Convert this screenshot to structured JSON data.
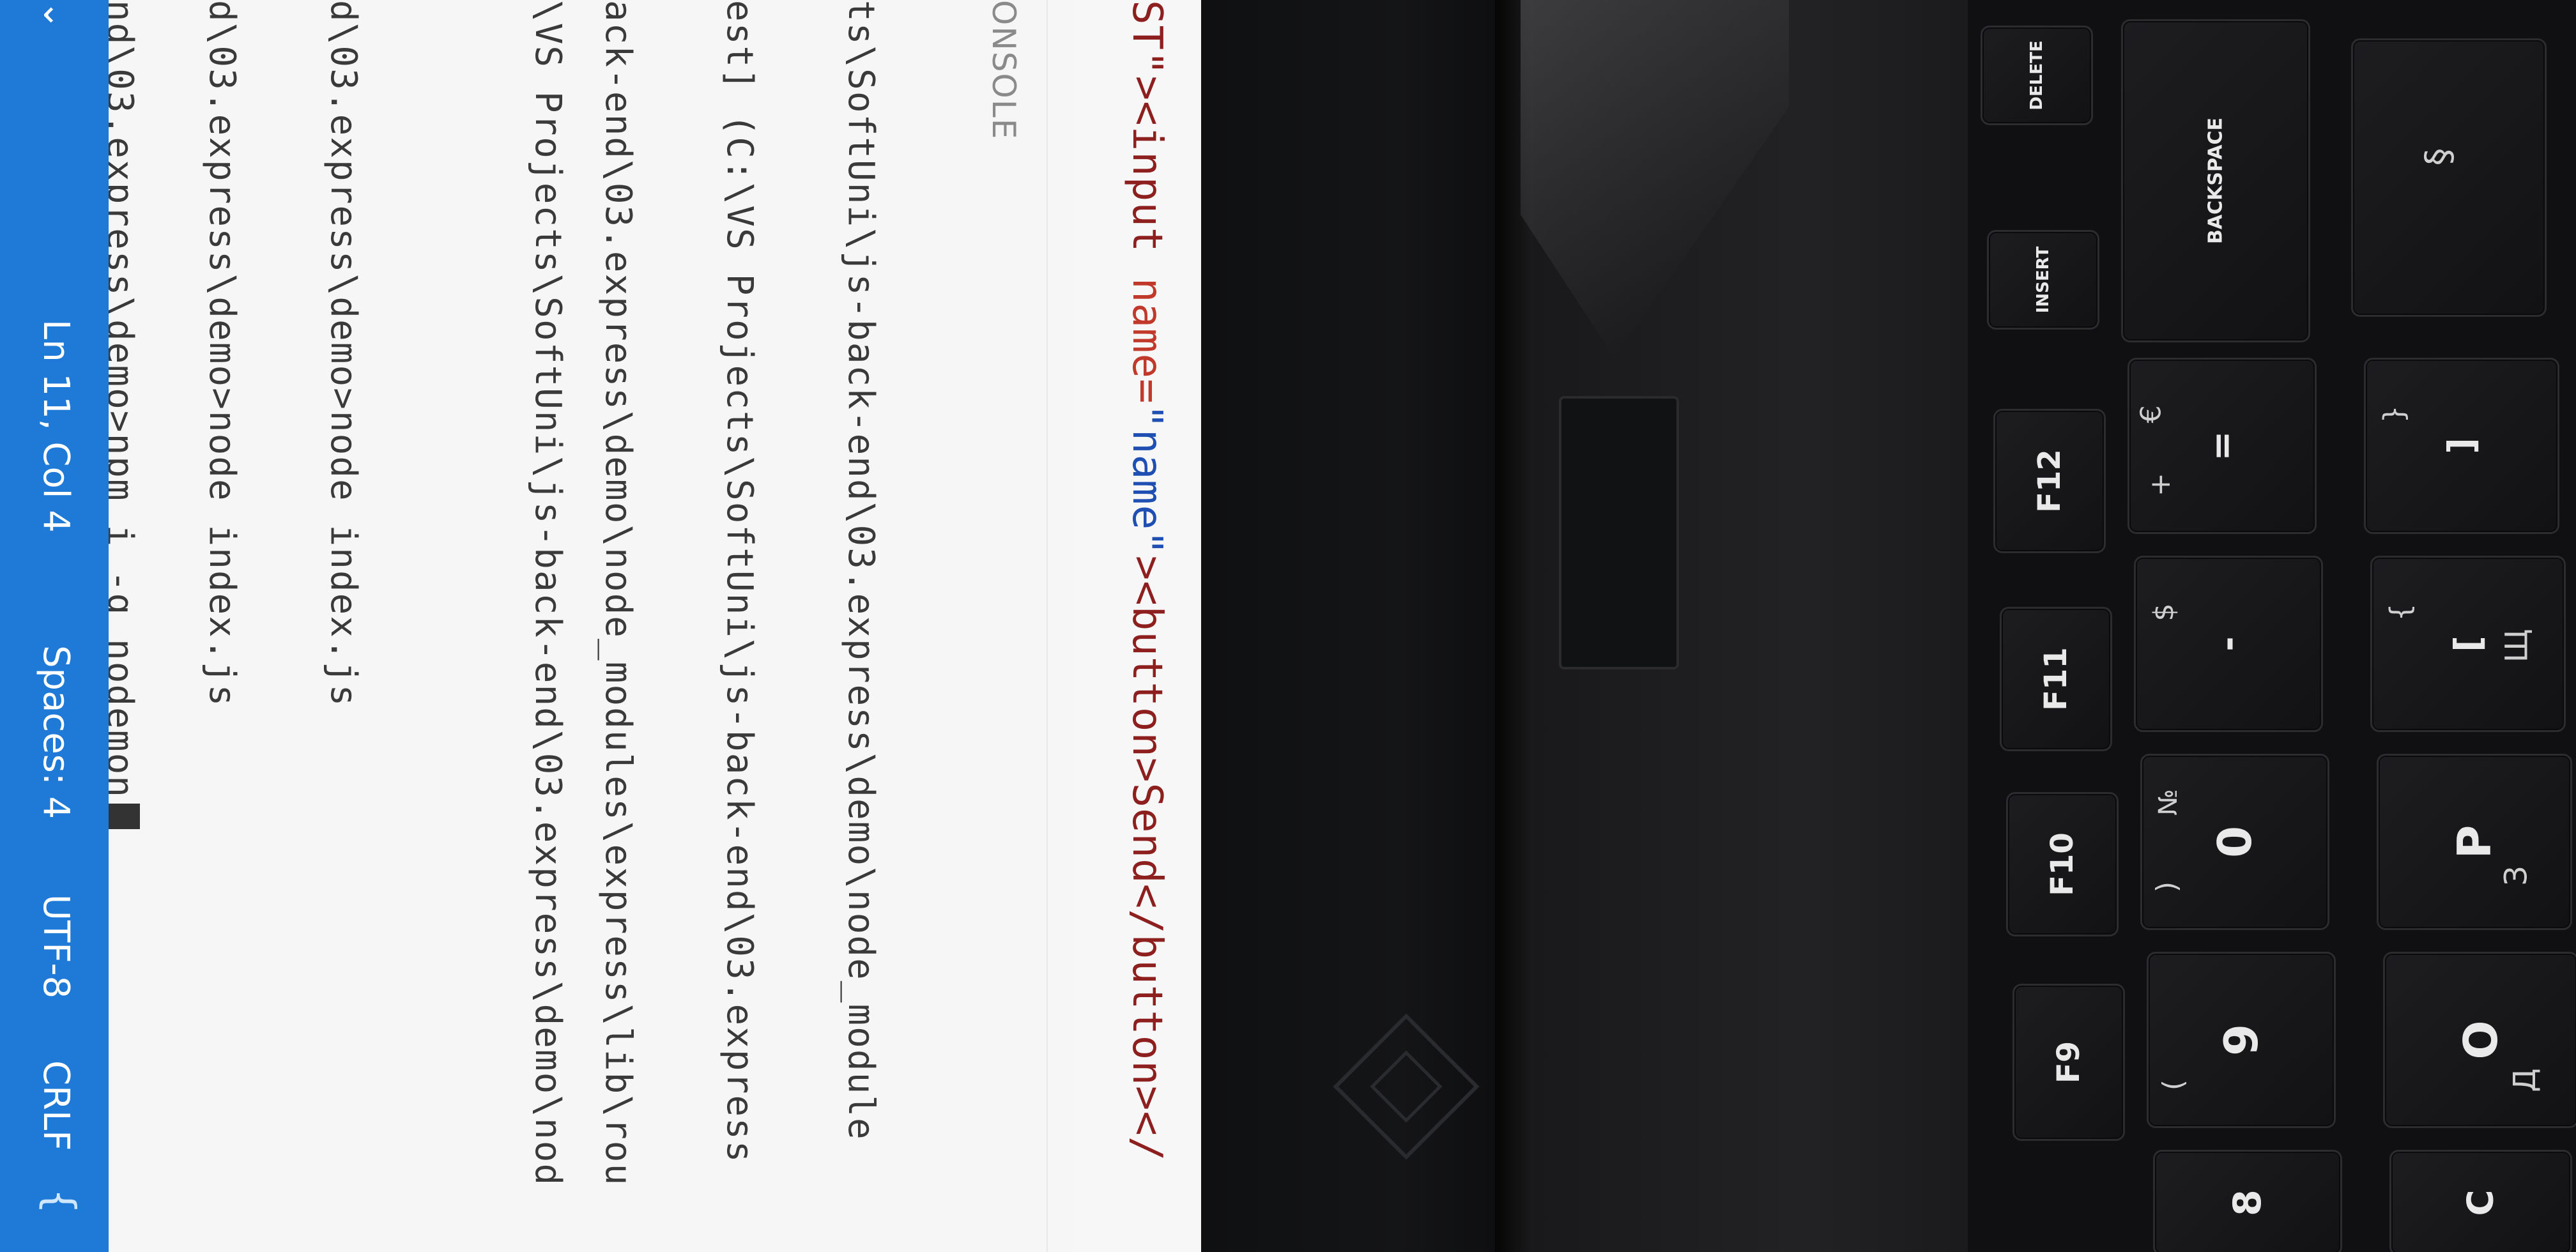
{
  "editor": {
    "code_line": {
      "prefix": "ST\">",
      "tag_open": "<input ",
      "attr": "name=",
      "value": "\"name\"",
      "rest": "><button>Send</button></"
    }
  },
  "panel": {
    "tab_label": "ONSOLE",
    "terminal_lines": [
      "ts\\SoftUni\\js-back-end\\03.express\\demo\\node_module",
      "est] (C:\\VS Projects\\SoftUni\\js-back-end\\03.express",
      "ack-end\\03.express\\demo\\node_modules\\express\\lib\\rou",
      "\\VS Projects\\SoftUni\\js-back-end\\03.express\\demo\\nod",
      "d\\03.express\\demo>node index.js",
      "d\\03.express\\demo>node index.js",
      "nd\\03.express\\demo>npm i -g nodemon"
    ]
  },
  "statusbar": {
    "position": "Ln 11, Col 4",
    "spaces": "Spaces: 4",
    "encoding": "UTF-8",
    "eol": "CRLF",
    "chevron": "chevron-down-icon",
    "brace": "{"
  },
  "keyboard": {
    "keys": {
      "delete": "DELETE",
      "insert": "INSERT",
      "f12": "F12",
      "f11": "F11",
      "f10": "F10",
      "f9": "F9",
      "backspace": "BACKSPACE",
      "equals": "=",
      "plus": "+",
      "euro": "€",
      "minus": "-",
      "dollar": "$",
      "zero": "0",
      "numero": "№",
      "paren_close": ")",
      "nine": "9",
      "paren_open": "(",
      "p": "P",
      "o": "O",
      "cyr_d": "Д",
      "cyr_z": "З",
      "cyr_shch": "Щ",
      "bracket_open": "[",
      "brace_open": "{",
      "bracket_close": "]",
      "brace_close": "}",
      "section": "§",
      "c_cyr": "C",
      "eight": "8"
    }
  },
  "colors": {
    "statusbar_bg": "#1e7ad6",
    "editor_bg": "#f4f4f4",
    "keyboard_bg": "#101012"
  }
}
